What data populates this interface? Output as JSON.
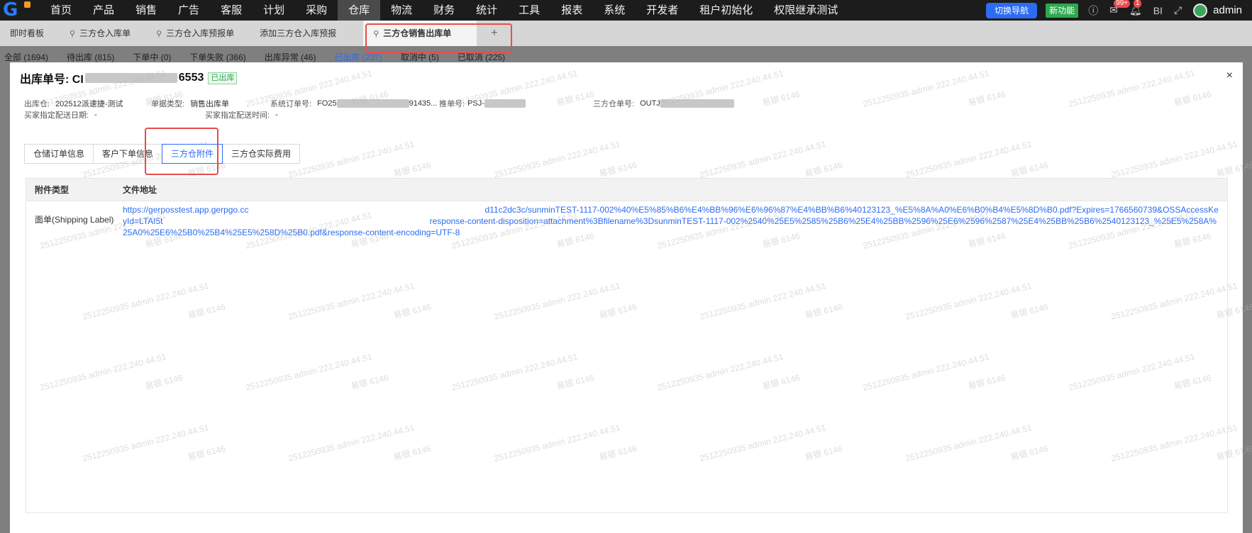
{
  "topnav": {
    "items": [
      "首页",
      "产品",
      "销售",
      "广告",
      "客服",
      "计划",
      "采购",
      "仓库",
      "物流",
      "财务",
      "统计",
      "工具",
      "报表",
      "系统",
      "开发者",
      "租户初始化",
      "权限继承测试"
    ],
    "active_index": 7,
    "switch_nav_label": "切换导航",
    "new_feature_label": "新功能",
    "mail_badge": "99+",
    "bell_badge": "1",
    "bi_label": "BI",
    "user_name": "admin",
    "brand_color": "#2b6cf2"
  },
  "tabs": [
    {
      "label": "即时看板",
      "pinned": false
    },
    {
      "label": "三方仓入库单",
      "pinned": true
    },
    {
      "label": "三方仓入库预报单",
      "pinned": true
    },
    {
      "label": "添加三方仓入库预报",
      "pinned": false
    },
    {
      "label": "三方仓销售出库单",
      "pinned": true,
      "active": true
    }
  ],
  "tab_add_label": "+",
  "status_filters": [
    {
      "label": "全部 (1694)",
      "active": false
    },
    {
      "label": "待出库 (815)",
      "active": false
    },
    {
      "label": "下单中 (0)",
      "active": false
    },
    {
      "label": "下单失败 (366)",
      "active": false
    },
    {
      "label": "出库异常 (46)",
      "active": false
    },
    {
      "label": "已出库 (237)",
      "active": true
    },
    {
      "label": "取消中 (5)",
      "active": false
    },
    {
      "label": "已取消 (225)",
      "active": false
    }
  ],
  "modal": {
    "title_prefix": "出库单号: CI",
    "title_suffix": "6553",
    "status_tag": "已出库",
    "close_label": "×",
    "meta": {
      "warehouse_label": "出库仓:",
      "warehouse_value": "202512派速捷-测试",
      "doc_type_label": "单据类型:",
      "doc_type_value": "销售出库单",
      "sys_order_label": "系统订单号:",
      "sys_order_prefix": "FO25",
      "sys_order_suffix": "91435...",
      "push_no_label": "推单号:",
      "push_no_prefix": "PSJ-",
      "tp_no_label": "三方仓单号:",
      "tp_no_prefix": "OUTJ",
      "delivery_date_label": "买家指定配送日期:",
      "delivery_date_value": "-",
      "delivery_time_label": "买家指定配送时间:",
      "delivery_time_value": "-"
    },
    "subtabs": [
      "仓储订单信息",
      "客户下单信息",
      "三方仓附件",
      "三方仓实际费用"
    ],
    "active_subtab": 2,
    "table": {
      "headers": [
        "附件类型",
        "文件地址"
      ],
      "rows": [
        {
          "type": "面单(Shipping Label)",
          "url_part1": "https://gerposstest.app.gerpgo.cc",
          "url_part2": "d11c2dc3c/sunminTEST-1117-002%40%E5%85%B6%E4%BB%96%E6%96%87%E4%BB%B6%40123123_%E5%8A%A0%E6%B0%B4%E5%8D%B0.pdf?Expires=1766560739&OSSAccessKeyId=LTAI5t",
          "url_part3": "response-content-disposition=attachment%3Bfilename%3DsunminTEST-1117-002%2540%25E5%2585%25B6%25E4%25BB%2596%25E6%2596%2587%25E4%25BB%25B6%2540123123_%25E5%258A%25A0%25E6%25B0%25B4%25E5%258D%25B0.pdf&response-content-encoding=UTF-8"
        }
      ]
    }
  },
  "watermark": {
    "line1": "易银 6146",
    "line2": "25122509​35 admin 222.240.44.51"
  }
}
